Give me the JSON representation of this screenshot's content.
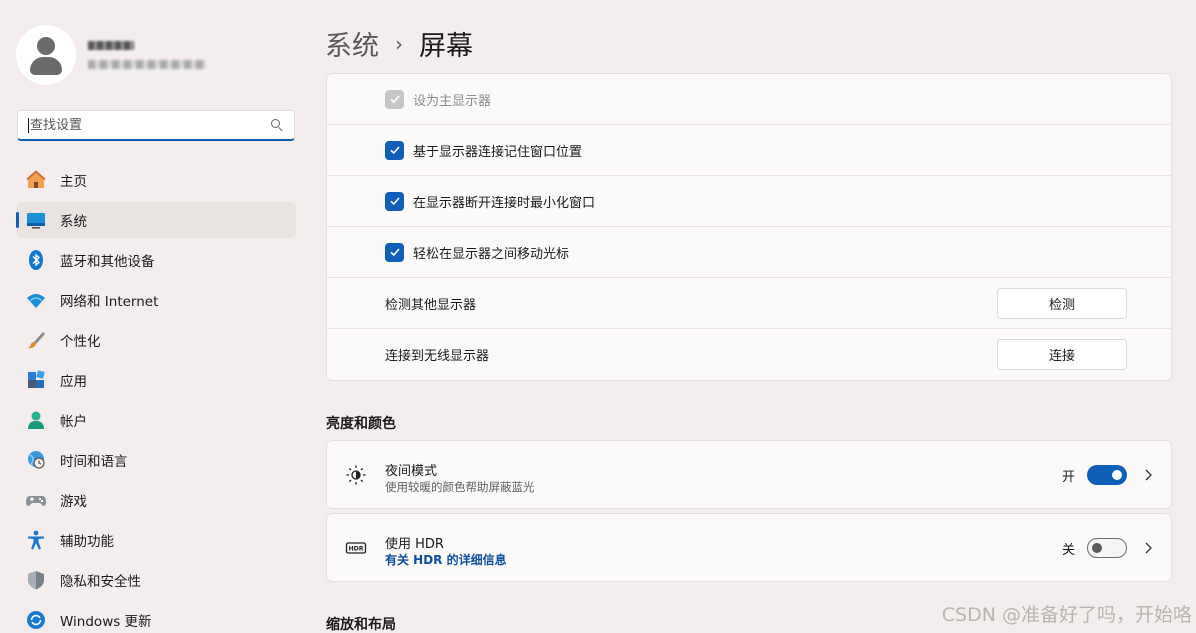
{
  "sidebar": {
    "search_placeholder": "查找设置",
    "items": [
      {
        "label": "主页",
        "icon": "home-icon"
      },
      {
        "label": "系统",
        "icon": "system-icon",
        "active": true
      },
      {
        "label": "蓝牙和其他设备",
        "icon": "bluetooth-icon"
      },
      {
        "label": "网络和 Internet",
        "icon": "wifi-icon"
      },
      {
        "label": "个性化",
        "icon": "brush-icon"
      },
      {
        "label": "应用",
        "icon": "apps-icon"
      },
      {
        "label": "帐户",
        "icon": "account-icon"
      },
      {
        "label": "时间和语言",
        "icon": "globe-clock-icon"
      },
      {
        "label": "游戏",
        "icon": "gamepad-icon"
      },
      {
        "label": "辅助功能",
        "icon": "accessibility-icon"
      },
      {
        "label": "隐私和安全性",
        "icon": "shield-icon"
      },
      {
        "label": "Windows 更新",
        "icon": "update-icon"
      }
    ]
  },
  "breadcrumb": {
    "parent": "系统",
    "separator": "›",
    "current": "屏幕"
  },
  "display_options": {
    "set_primary": {
      "label": "设为主显示器",
      "checked": true,
      "disabled": true
    },
    "remember_positions": {
      "label": "基于显示器连接记住窗口位置",
      "checked": true
    },
    "minimize_on_disconnect": {
      "label": "在显示器断开连接时最小化窗口",
      "checked": true
    },
    "ease_cursor": {
      "label": "轻松在显示器之间移动光标",
      "checked": true
    },
    "detect": {
      "label": "检测其他显示器",
      "button": "检测"
    },
    "connect": {
      "label": "连接到无线显示器",
      "button": "连接"
    }
  },
  "brightness_section": {
    "title": "亮度和颜色"
  },
  "night_light": {
    "title": "夜间模式",
    "subtitle": "使用较暖的颜色帮助屏蔽蓝光",
    "state_label": "开",
    "on": true
  },
  "hdr": {
    "title": "使用 HDR",
    "link": "有关 HDR 的详细信息",
    "state_label": "关",
    "on": false
  },
  "layout_section": {
    "title": "缩放和布局"
  },
  "watermark": "CSDN @准备好了吗，开始咯",
  "colors": {
    "accent": "#0f5fb8",
    "background": "#f3eeed",
    "card": "#fbfaf9"
  }
}
